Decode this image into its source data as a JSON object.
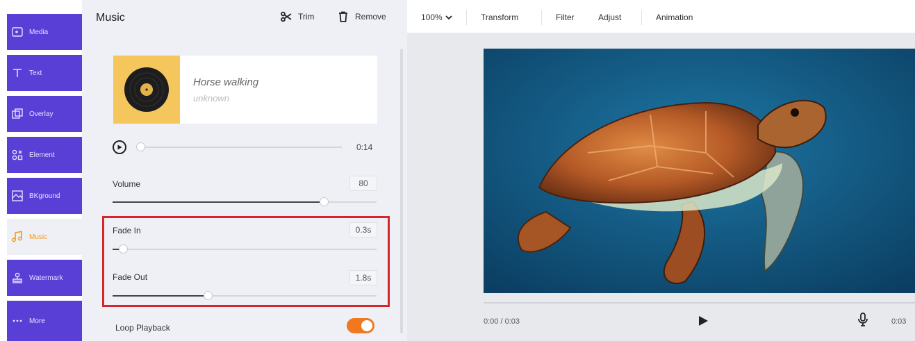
{
  "sidebar": {
    "items": [
      {
        "label": "Media",
        "icon": "media-icon"
      },
      {
        "label": "Text",
        "icon": "text-icon"
      },
      {
        "label": "Overlay",
        "icon": "overlay-icon"
      },
      {
        "label": "Element",
        "icon": "element-icon"
      },
      {
        "label": "BKground",
        "icon": "background-icon"
      },
      {
        "label": "Music",
        "icon": "music-icon",
        "active": true
      },
      {
        "label": "Watermark",
        "icon": "watermark-icon"
      },
      {
        "label": "More",
        "icon": "more-icon"
      }
    ],
    "accent": "#5a3fd6",
    "active_color": "#f29a1c"
  },
  "panel": {
    "title": "Music",
    "trim_label": "Trim",
    "remove_label": "Remove",
    "track": {
      "title": "Horse walking",
      "artist": "unknown"
    },
    "duration": "0:14",
    "playback_progress": 0.0,
    "volume": {
      "label": "Volume",
      "value": "80",
      "level": 0.8
    },
    "fade_in": {
      "label": "Fade In",
      "value": "0.3s",
      "level": 0.04
    },
    "fade_out": {
      "label": "Fade Out",
      "value": "1.8s",
      "level": 0.36
    },
    "loop": {
      "label": "Loop Playback",
      "enabled": true
    },
    "highlight_color": "#d6262c",
    "toggle_color": "#f2781f"
  },
  "toolbar": {
    "zoom": "100%",
    "transform": "Transform",
    "filter": "Filter",
    "adjust": "Adjust",
    "animation": "Animation"
  },
  "player": {
    "time": "0:00 / 0:03",
    "end_time": "0:03"
  }
}
